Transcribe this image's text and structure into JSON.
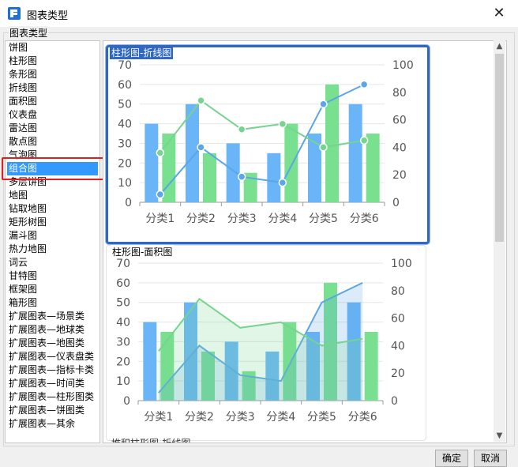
{
  "window": {
    "title": "图表类型",
    "close_glyph": "✕"
  },
  "group_label": "图表类型",
  "chart_types": [
    "饼图",
    "柱形图",
    "条形图",
    "折线图",
    "面积图",
    "仪表盘",
    "雷达图",
    "散点图",
    "气泡图",
    "组合图",
    "多层饼图",
    "地图",
    "钻取地图",
    "矩形树图",
    "漏斗图",
    "热力地图",
    "词云",
    "甘特图",
    "框架图",
    "箱形图",
    "扩展图表—场景类",
    "扩展图表—地球类",
    "扩展图表—地图类",
    "扩展图表—仪表盘类",
    "扩展图表—指标卡类",
    "扩展图表—时间类",
    "扩展图表—柱形图类",
    "扩展图表—饼图类",
    "扩展图表—其余"
  ],
  "selected_index": 9,
  "preview_cards": [
    {
      "title": "柱形图-折线图",
      "selected": true,
      "chart_data": {
        "type": "bar+line",
        "categories": [
          "分类1",
          "分类2",
          "分类3",
          "分类4",
          "分类5",
          "分类6"
        ],
        "ylim_left": [
          0,
          70
        ],
        "yticks_left": [
          0,
          10,
          20,
          30,
          40,
          50,
          60,
          70
        ],
        "ylim_right": [
          0,
          100
        ],
        "yticks_right": [
          0,
          20,
          40,
          60,
          80,
          100
        ],
        "series": [
          {
            "type": "bar",
            "color": "#6ab4f8",
            "values": [
              40,
              50,
              30,
              25,
              35,
              50
            ]
          },
          {
            "type": "bar",
            "color": "#79e08f",
            "values": [
              35,
              25,
              15,
              40,
              60,
              35
            ]
          },
          {
            "type": "line",
            "axis": "left",
            "color": "#5aa6e6",
            "marker": true,
            "values": [
              4,
              28,
              13,
              10,
              50,
              60
            ]
          },
          {
            "type": "line",
            "axis": "right",
            "color": "#76d490",
            "marker": true,
            "values": [
              36,
              74,
              53,
              57,
              40,
              45
            ]
          }
        ]
      }
    },
    {
      "title": "柱形图-面积图",
      "selected": false,
      "chart_data": {
        "type": "bar+area",
        "categories": [
          "分类1",
          "分类2",
          "分类3",
          "分类4",
          "分类5",
          "分类6"
        ],
        "ylim_left": [
          0,
          70
        ],
        "yticks_left": [
          0,
          10,
          20,
          30,
          40,
          50,
          60,
          70
        ],
        "ylim_right": [
          0,
          100
        ],
        "yticks_right": [
          0,
          20,
          40,
          60,
          80,
          100
        ],
        "series": [
          {
            "type": "bar",
            "color": "#6ab4f8",
            "values": [
              40,
              50,
              30,
              25,
              35,
              50
            ]
          },
          {
            "type": "bar",
            "color": "#79e08f",
            "values": [
              35,
              25,
              15,
              40,
              60,
              35
            ]
          },
          {
            "type": "area",
            "axis": "left",
            "color": "#5aa6e6",
            "marker": false,
            "values": [
              4,
              28,
              13,
              10,
              50,
              60
            ]
          },
          {
            "type": "area",
            "axis": "right",
            "color": "#76d490",
            "marker": false,
            "values": [
              36,
              74,
              53,
              57,
              40,
              45
            ]
          }
        ]
      }
    }
  ],
  "partial_card_title": "堆积柱形图-折线图",
  "buttons": {
    "ok": "确定",
    "cancel": "取消"
  },
  "icons": {
    "app": "fine-report-logo-icon",
    "scroll_up": "▲",
    "scroll_down": "▼"
  }
}
